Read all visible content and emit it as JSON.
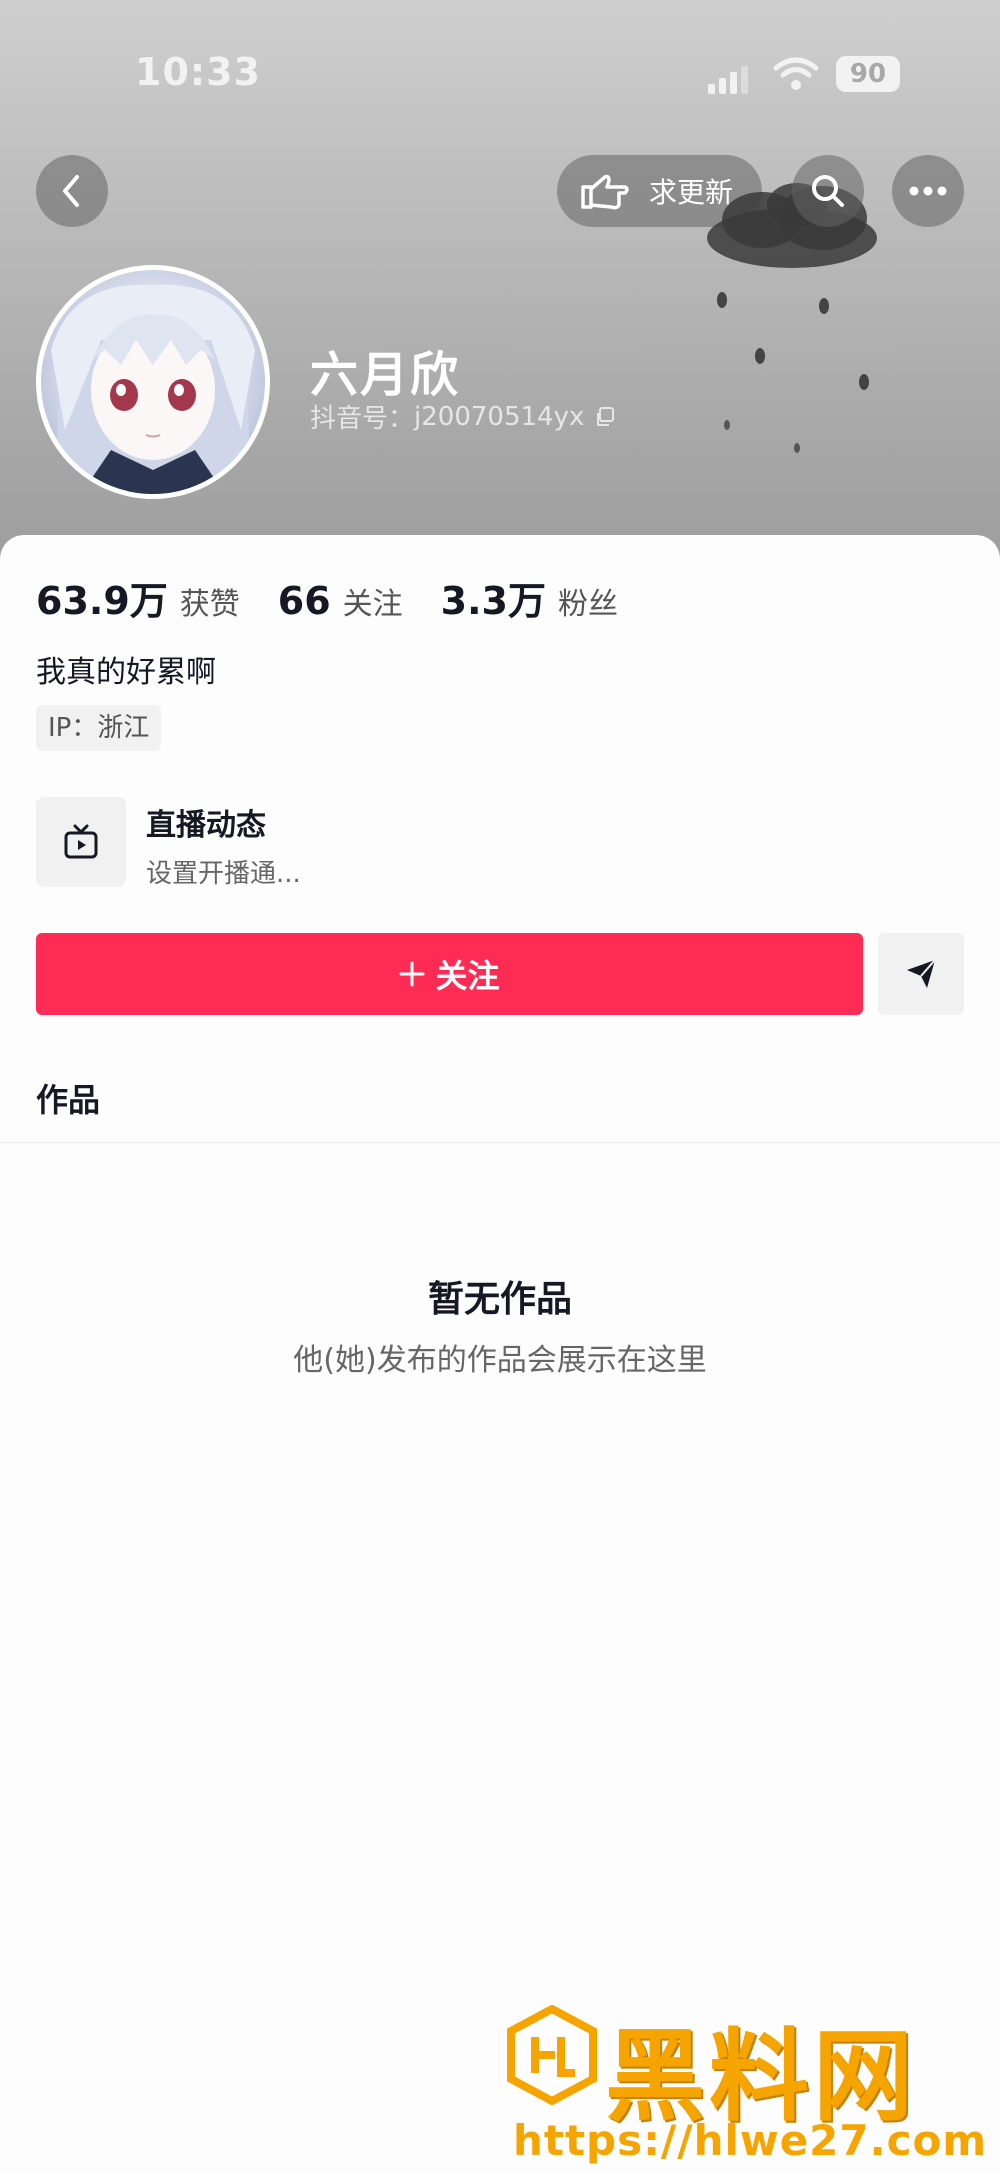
{
  "status_bar": {
    "time": "10:33",
    "battery": "90"
  },
  "header": {
    "request_update_label": "求更新",
    "profile": {
      "name": "六月欣",
      "douyin_id_label": "抖音号：",
      "douyin_id": "j20070514yx"
    }
  },
  "stats": [
    {
      "value": "63.9万",
      "label": "获赞"
    },
    {
      "value": "66",
      "label": "关注"
    },
    {
      "value": "3.3万",
      "label": "粉丝"
    }
  ],
  "bio": "我真的好累啊",
  "ip": "IP：浙江",
  "live": {
    "title": "直播动态",
    "subtitle": "设置开播通..."
  },
  "follow_label": "关注",
  "tab_works": "作品",
  "empty": {
    "title": "暂无作品",
    "subtitle": "他(她)发布的作品会展示在这里"
  },
  "watermark": {
    "brand": "黑料网",
    "url": "https://hlwe27.com"
  },
  "colors": {
    "accent": "#fe2c55",
    "watermark": "#f5a400"
  },
  "icons": [
    "back-icon",
    "pointing-hand-icon",
    "search-icon",
    "more-icon",
    "copy-icon",
    "tv-icon",
    "plus-icon",
    "send-icon"
  ]
}
